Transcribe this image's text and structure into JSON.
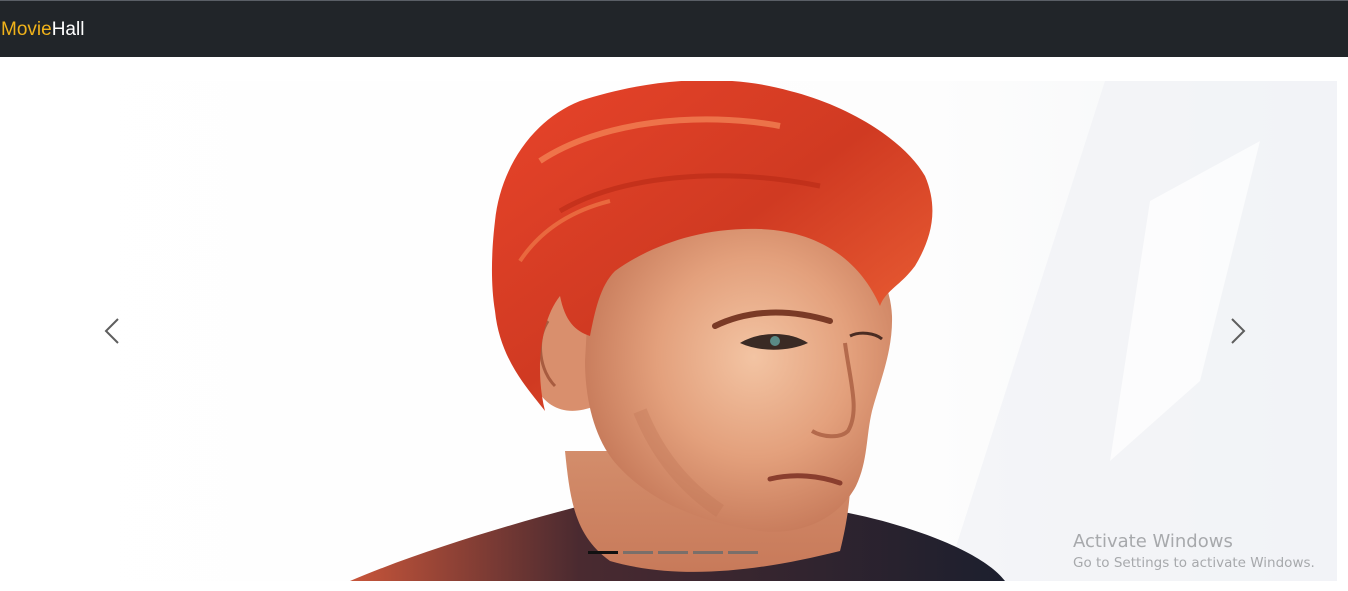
{
  "navbar": {
    "brand_part1": "Movie",
    "brand_part2": "Hall",
    "background": "#212529",
    "brand_accent": "#f0b21a"
  },
  "carousel": {
    "slides_count": 5,
    "active_index": 0,
    "prev_icon": "chevron-left-icon",
    "next_icon": "chevron-right-icon"
  },
  "watermark": {
    "title": "Activate Windows",
    "subtitle": "Go to Settings to activate Windows."
  }
}
